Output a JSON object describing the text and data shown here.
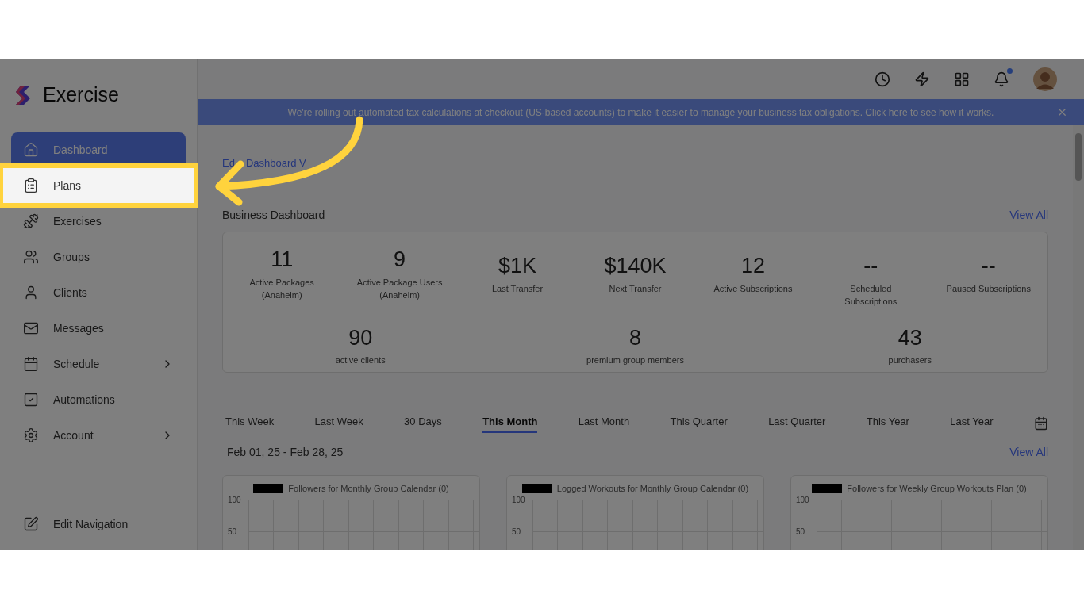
{
  "sidebar": {
    "logo": "Exercise",
    "items": [
      {
        "label": "Dashboard",
        "selected": true,
        "highlighted": false,
        "has_submenu": false
      },
      {
        "label": "Plans",
        "selected": false,
        "highlighted": true,
        "has_submenu": false
      },
      {
        "label": "Exercises",
        "selected": false,
        "highlighted": false,
        "has_submenu": false
      },
      {
        "label": "Groups",
        "selected": false,
        "highlighted": false,
        "has_submenu": false
      },
      {
        "label": "Clients",
        "selected": false,
        "highlighted": false,
        "has_submenu": false
      },
      {
        "label": "Messages",
        "selected": false,
        "highlighted": false,
        "has_submenu": false
      },
      {
        "label": "Schedule",
        "selected": false,
        "highlighted": false,
        "has_submenu": true
      },
      {
        "label": "Automations",
        "selected": false,
        "highlighted": false,
        "has_submenu": false
      },
      {
        "label": "Account",
        "selected": false,
        "highlighted": false,
        "has_submenu": true
      }
    ],
    "footer_item": "Edit Navigation"
  },
  "topbar": {
    "notifications_unread": true
  },
  "banner": {
    "text": "We're rolling out automated tax calculations at checkout (US-based accounts) to make it easier to manage your business tax obligations.",
    "link": "Click here to see how it works."
  },
  "edit_link": {
    "before_arrow": "Ed",
    "after_arrow": "Dashboard V"
  },
  "business": {
    "title": "Business Dashboard",
    "view_all": "View All",
    "stats_top": [
      {
        "value": "11",
        "label": "Active Packages (Anaheim)"
      },
      {
        "value": "9",
        "label": "Active Package Users (Anaheim)"
      },
      {
        "value": "$1K",
        "label": "Last Transfer"
      },
      {
        "value": "$140K",
        "label": "Next Transfer"
      },
      {
        "value": "12",
        "label": "Active Subscriptions"
      },
      {
        "value": "--",
        "label": "Scheduled Subscriptions"
      },
      {
        "value": "--",
        "label": "Paused Subscriptions"
      }
    ],
    "stats_bottom": [
      {
        "value": "90",
        "label": "active clients"
      },
      {
        "value": "8",
        "label": "premium group members"
      },
      {
        "value": "43",
        "label": "purchasers"
      }
    ]
  },
  "periods": [
    {
      "label": "This Week",
      "selected": false
    },
    {
      "label": "Last Week",
      "selected": false
    },
    {
      "label": "30 Days",
      "selected": false
    },
    {
      "label": "This Month",
      "selected": true
    },
    {
      "label": "Last Month",
      "selected": false
    },
    {
      "label": "This Quarter",
      "selected": false
    },
    {
      "label": "Last Quarter",
      "selected": false
    },
    {
      "label": "This Year",
      "selected": false
    },
    {
      "label": "Last Year",
      "selected": false
    }
  ],
  "date_range": "Feb 01, 25 - Feb 28, 25",
  "view_all": "View All",
  "charts": [
    {
      "legend": "Followers for Monthly Group Calendar (0)",
      "color": "#000000",
      "axis_labels": [
        "100",
        "50"
      ]
    },
    {
      "legend": "Logged Workouts for Monthly Group Calendar (0)",
      "color": "#000000",
      "axis_labels": [
        "100",
        "50"
      ]
    },
    {
      "legend": "Followers for Weekly Group Workouts Plan (0)",
      "color": "#000000",
      "axis_labels": [
        "100",
        "50"
      ]
    }
  ]
}
